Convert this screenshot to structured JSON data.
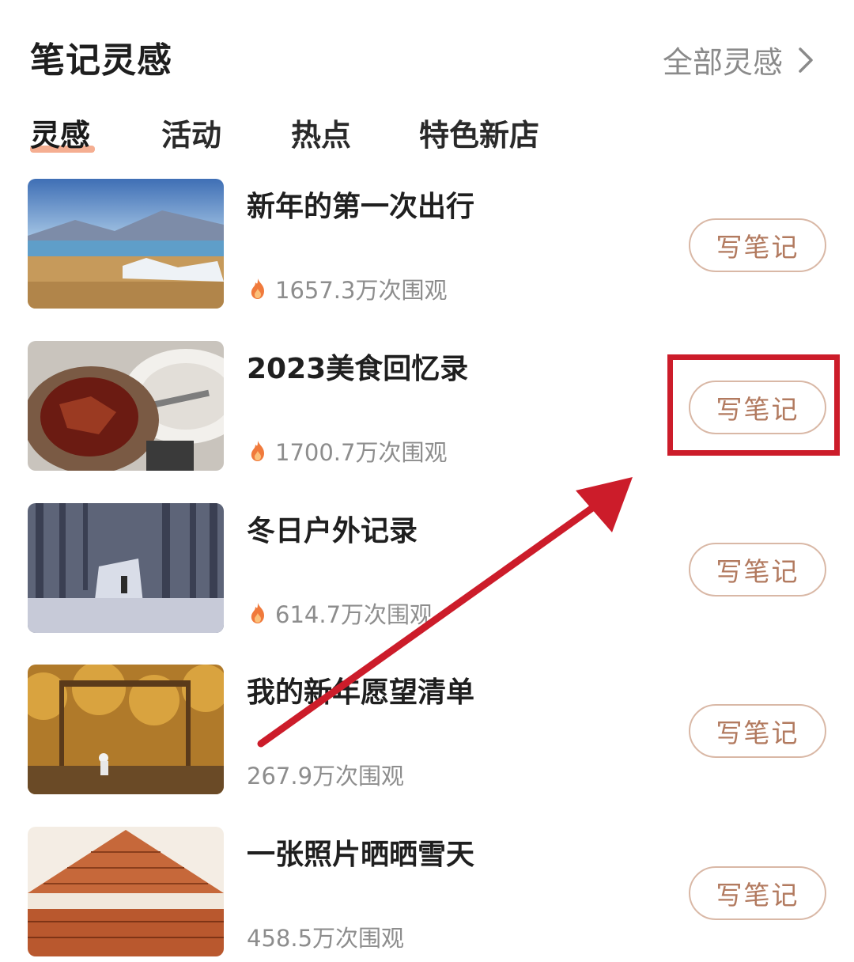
{
  "header": {
    "title": "笔记灵感",
    "all_link": "全部灵感"
  },
  "tabs": [
    {
      "label": "灵感",
      "active": true
    },
    {
      "label": "活动",
      "active": false
    },
    {
      "label": "热点",
      "active": false
    },
    {
      "label": "特色新店",
      "active": false
    }
  ],
  "items": [
    {
      "title": "新年的第一次出行",
      "views": "1657.3万次围观",
      "hot": true,
      "button": "写笔记"
    },
    {
      "title": "2023美食回忆录",
      "views": "1700.7万次围观",
      "hot": true,
      "button": "写笔记"
    },
    {
      "title": "冬日户外记录",
      "views": "614.7万次围观",
      "hot": true,
      "button": "写笔记"
    },
    {
      "title": "我的新年愿望清单",
      "views": "267.9万次围观",
      "hot": false,
      "button": "写笔记"
    },
    {
      "title": "一张照片晒晒雪天",
      "views": "458.5万次围观",
      "hot": false,
      "button": "写笔记"
    }
  ],
  "colors": {
    "accent_underline": "#f3a07e",
    "button_text": "#b27a5f",
    "button_border": "#d9b8a6",
    "flame": "#f07a3c",
    "annotation_red": "#cc1c2a"
  }
}
